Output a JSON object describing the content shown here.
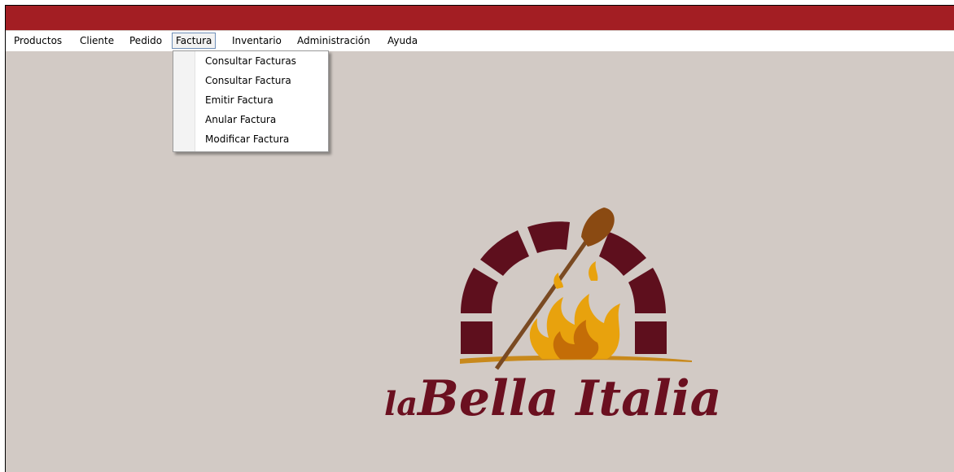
{
  "window": {
    "title_color": "#a31e23",
    "background": "#d2cac5"
  },
  "menu": {
    "items": [
      "Productos",
      "Cliente",
      "Pedido",
      "Factura",
      "Inventario",
      "Administración",
      "Ayuda"
    ],
    "open_menu": "Factura"
  },
  "factura_menu": {
    "items": [
      "Consultar Facturas",
      "Consultar Factura",
      "Emitir Factura",
      "Anular Factura",
      "Modificar Factura"
    ]
  },
  "logo": {
    "text_la": "la",
    "text_main": "Bella Italia",
    "brand_color": "#6b1020",
    "flame_color": "#e8a20d"
  }
}
